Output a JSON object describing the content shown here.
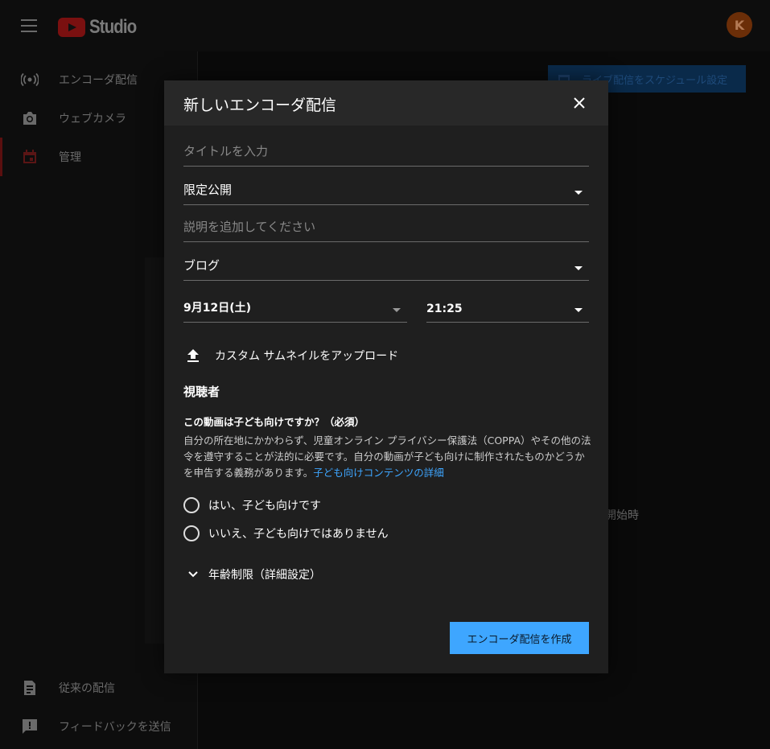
{
  "app": {
    "logo_text": "Studio",
    "avatar_letter": "K"
  },
  "sidebar": {
    "items": [
      {
        "label": "エンコーダ配信",
        "icon": "broadcast-icon"
      },
      {
        "label": "ウェブカメラ",
        "icon": "camera-icon"
      },
      {
        "label": "管理",
        "icon": "calendar-icon"
      }
    ],
    "bottom_items": [
      {
        "label": "従来の配信",
        "icon": "legacy-icon"
      },
      {
        "label": "フィードバックを送信",
        "icon": "feedback-icon"
      }
    ]
  },
  "main": {
    "schedule_button_label": "ライブ配信をスケジュール設定",
    "partial_text": "開始時"
  },
  "dialog": {
    "title": "新しいエンコーダ配信",
    "title_input_placeholder": "タイトルを入力",
    "visibility_value": "限定公開",
    "description_placeholder": "説明を追加してください",
    "category_value": "ブログ",
    "date_value": "9月12日(土)",
    "time_value": "21:25",
    "upload_thumbnail_label": "カスタム サムネイルをアップロード",
    "audience_title": "視聴者",
    "kids_question": "この動画は子ども向けですか？（必須）",
    "kids_explanation": "自分の所在地にかかわらず、児童オンライン プライバシー保護法（COPPA）やその他の法令を遵守することが法的に必要です。自分の動画が子ども向けに制作されたものかどうかを申告する義務があります。",
    "kids_link": "子ども向けコンテンツの詳細",
    "radio_yes": "はい、子ども向けです",
    "radio_no": "いいえ、子ども向けではありません",
    "age_restriction_label": "年齢制限（詳細設定）",
    "create_button": "エンコーダ配信を作成"
  },
  "colors": {
    "accent": "#3ea6ff",
    "dialog_bg": "#1f1f1f",
    "header_bg": "#282828"
  }
}
